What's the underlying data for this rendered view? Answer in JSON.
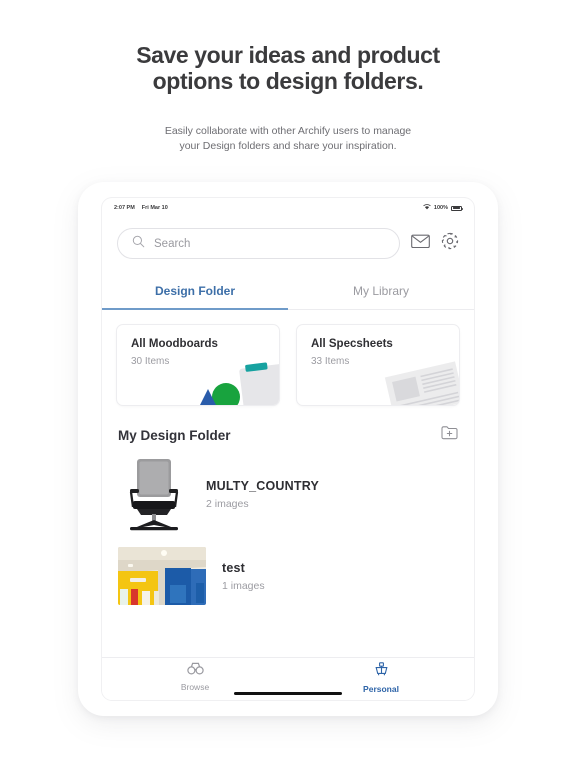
{
  "promo": {
    "title_line1": "Save your ideas and product",
    "title_line2": "options to design folders.",
    "sub_line1": "Easily collaborate with other Archify users to manage",
    "sub_line2": "your Design folders and share your inspiration."
  },
  "statusbar": {
    "time": "2:07 PM",
    "date": "Fri Mar 10",
    "battery_pct": "100%",
    "wifi_icon": "wifi-icon",
    "battery_icon": "battery-icon"
  },
  "search": {
    "placeholder": "Search",
    "icon": "search-icon"
  },
  "header_icons": {
    "mail": "mail-icon",
    "settings": "gear-icon"
  },
  "tabs": [
    {
      "label": "Design Folder",
      "active": true
    },
    {
      "label": "My Library",
      "active": false
    }
  ],
  "summary_cards": [
    {
      "title": "All Moodboards",
      "subtitle": "30 Items",
      "art": "moodboard-art"
    },
    {
      "title": "All Specsheets",
      "subtitle": "33 Items",
      "art": "specsheet-art"
    }
  ],
  "section": {
    "title": "My Design Folder",
    "add_icon": "add-folder-icon"
  },
  "folders": [
    {
      "name": "MULTY_COUNTRY",
      "count": "2 images",
      "thumb": "office-chair-thumbnail"
    },
    {
      "name": "test",
      "count": "1 images",
      "thumb": "interior-room-thumbnail"
    }
  ],
  "bottom_tabs": [
    {
      "label": "Browse",
      "icon": "binoculars-icon",
      "active": false
    },
    {
      "label": "Personal",
      "icon": "cube-icon",
      "active": true
    }
  ],
  "colors": {
    "accent_blue": "#3d6fa8",
    "active_blue": "#2e64a8",
    "underline_blue": "#6f9bc9",
    "muted_gray": "#9a9aa0",
    "art_green": "#18a33e",
    "art_blue": "#2a5caa",
    "art_teal": "#17a2a0"
  }
}
